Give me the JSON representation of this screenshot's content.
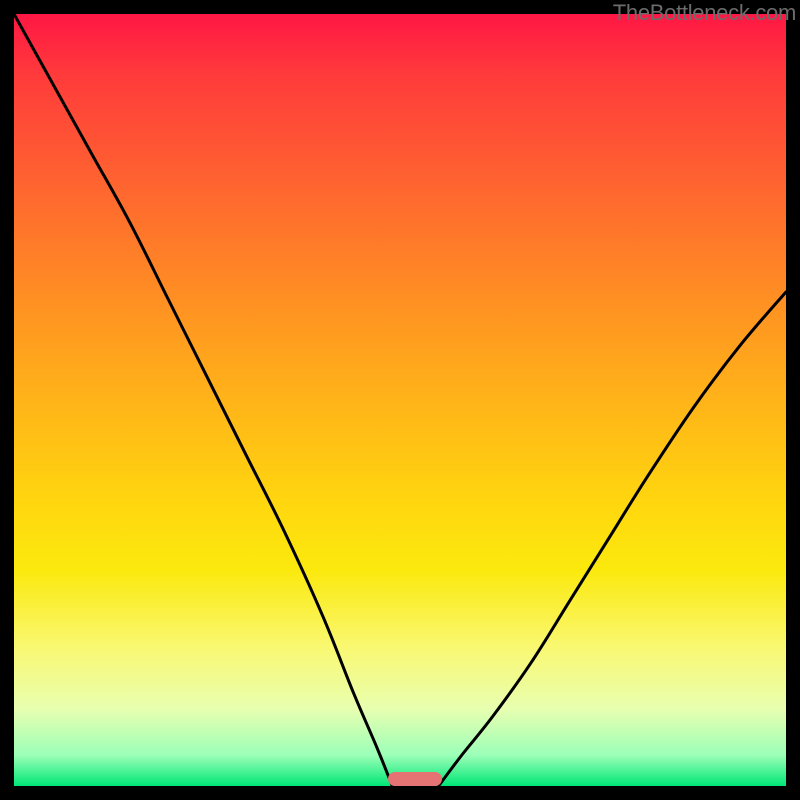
{
  "watermark": "TheBottleneck.com",
  "colors": {
    "top": "#ff1744",
    "bottom": "#00e676",
    "curve": "#000000",
    "marker": "#e57373",
    "frame": "#000000"
  },
  "chart_data": {
    "type": "line",
    "title": "",
    "xlabel": "",
    "ylabel": "",
    "xlim": [
      0,
      100
    ],
    "ylim": [
      0,
      100
    ],
    "series": [
      {
        "name": "left-curve",
        "x": [
          0,
          5,
          10,
          15,
          20,
          25,
          30,
          35,
          40,
          44,
          47,
          49
        ],
        "values": [
          100,
          91,
          82,
          73,
          63,
          53,
          43,
          33,
          22,
          12,
          5,
          0
        ]
      },
      {
        "name": "right-curve",
        "x": [
          55,
          58,
          62,
          67,
          72,
          77,
          82,
          88,
          94,
          100
        ],
        "values": [
          0,
          4,
          9,
          16,
          24,
          32,
          40,
          49,
          57,
          64
        ]
      }
    ],
    "marker": {
      "x_center": 52,
      "width_pct": 7
    }
  }
}
